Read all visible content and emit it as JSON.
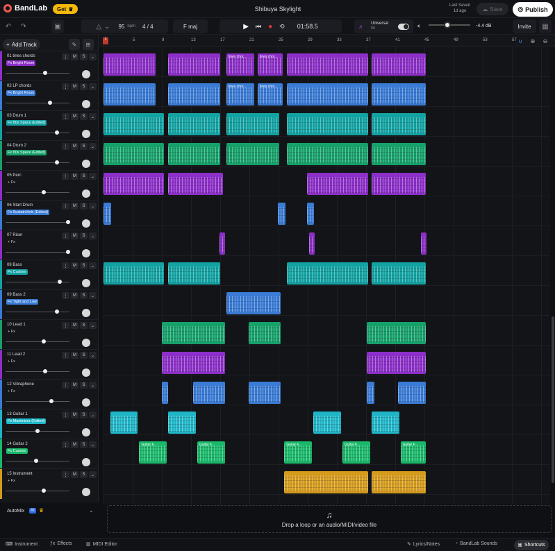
{
  "app": {
    "logo": "BandLab",
    "get_label": "Get",
    "project_title": "Shibuya Skylight",
    "last_saved_label": "Last Saved",
    "last_saved_time": "1d ago",
    "save_label": "Save",
    "publish_label": "Publish"
  },
  "toolbar": {
    "tempo": "95",
    "tempo_unit": "bpm",
    "time_signature": "4 / 4",
    "key": "F maj",
    "time": "01:58.5",
    "preset_name": "Universal",
    "preset_value": "50",
    "volume_db": "-4.4 dB",
    "invite_label": "Invite"
  },
  "panel": {
    "add_track_label": "Add Track",
    "automix_label": "AutoMix",
    "automix_badge": "AI"
  },
  "ruler": {
    "marks": [
      "5",
      "9",
      "13",
      "17",
      "21",
      "25",
      "29",
      "33",
      "37",
      "41",
      "45",
      "49",
      "53",
      "57"
    ],
    "start": "1"
  },
  "tracks": [
    {
      "name": "01  tines chords",
      "fx": "Fx Bright Room",
      "color": "#8c2fc8",
      "vol": 0.62
    },
    {
      "name": "02  LP chords",
      "fx": "Fx Bright Room",
      "color": "#3a7bd5",
      "vol": 0.7
    },
    {
      "name": "03  Drum 1",
      "fx": "Fx 80s Space (Edited)",
      "color": "#13a2a2",
      "vol": 0.8
    },
    {
      "name": "04  Drum 2",
      "fx": "Fx 80s Space (Edited)",
      "color": "#16a06a",
      "vol": 0.8
    },
    {
      "name": "05  Perc",
      "fx": "+ Fx",
      "color": "#8c2fc8",
      "vol": 0.6
    },
    {
      "name": "06  Start Drum",
      "fx": "Fx SustainVerb (Edited)",
      "color": "#3a7bd5",
      "vol": 0.98
    },
    {
      "name": "07  Riser",
      "fx": "+ Fx",
      "color": "#8c2fc8",
      "vol": 0.98
    },
    {
      "name": "08  Bass",
      "fx": "Fx Custom",
      "color": "#13a2a2",
      "vol": 0.85
    },
    {
      "name": "09  Bass 2",
      "fx": "Fx Tight and Low",
      "color": "#3a7bd5",
      "vol": 0.8
    },
    {
      "name": "10  Lead 1",
      "fx": "+ Fx",
      "color": "#16a06a",
      "vol": 0.6
    },
    {
      "name": "11  Lead 2",
      "fx": "+ Fx",
      "color": "#8c2fc8",
      "vol": 0.62
    },
    {
      "name": "12  Vibraphone",
      "fx": "+ Fx",
      "color": "#3a7bd5",
      "vol": 0.72
    },
    {
      "name": "13  Guitar 1",
      "fx": "Fx Maximizer (Edited)",
      "color": "#1fb5c7",
      "vol": 0.5
    },
    {
      "name": "14  Guitar 2",
      "fx": "Fx Custom",
      "color": "#1ab86a",
      "vol": 0.48
    },
    {
      "name": "15  Instrument",
      "fx": "+ Fx",
      "color": "#d49a1c",
      "vol": 0.6
    }
  ],
  "clips": [
    {
      "lane": 0,
      "start": 0.0,
      "end": 0.12,
      "color": "#8c2fc8",
      "label": ""
    },
    {
      "lane": 0,
      "start": 0.145,
      "end": 0.265,
      "color": "#8c2fc8",
      "label": ""
    },
    {
      "lane": 0,
      "start": 0.275,
      "end": 0.34,
      "color": "#8c2fc8",
      "label": "tines chor..."
    },
    {
      "lane": 0,
      "start": 0.345,
      "end": 0.405,
      "color": "#8c2fc8",
      "label": "tines chor..."
    },
    {
      "lane": 0,
      "start": 0.41,
      "end": 0.595,
      "color": "#8c2fc8",
      "label": ""
    },
    {
      "lane": 0,
      "start": 0.6,
      "end": 0.725,
      "color": "#8c2fc8",
      "label": ""
    },
    {
      "lane": 1,
      "start": 0.0,
      "end": 0.12,
      "color": "#3a7bd5",
      "label": ""
    },
    {
      "lane": 1,
      "start": 0.145,
      "end": 0.265,
      "color": "#3a7bd5",
      "label": ""
    },
    {
      "lane": 1,
      "start": 0.275,
      "end": 0.34,
      "color": "#3a7bd5",
      "label": "tines chor..."
    },
    {
      "lane": 1,
      "start": 0.345,
      "end": 0.405,
      "color": "#3a7bd5",
      "label": "tines chor..."
    },
    {
      "lane": 1,
      "start": 0.41,
      "end": 0.595,
      "color": "#3a7bd5",
      "label": ""
    },
    {
      "lane": 1,
      "start": 0.6,
      "end": 0.725,
      "color": "#3a7bd5",
      "label": ""
    },
    {
      "lane": 2,
      "start": 0.0,
      "end": 0.138,
      "color": "#13a2a2",
      "label": ""
    },
    {
      "lane": 2,
      "start": 0.145,
      "end": 0.265,
      "color": "#13a2a2",
      "label": ""
    },
    {
      "lane": 2,
      "start": 0.275,
      "end": 0.397,
      "color": "#13a2a2",
      "label": ""
    },
    {
      "lane": 2,
      "start": 0.41,
      "end": 0.595,
      "color": "#13a2a2",
      "label": ""
    },
    {
      "lane": 2,
      "start": 0.6,
      "end": 0.725,
      "color": "#13a2a2",
      "label": ""
    },
    {
      "lane": 3,
      "start": 0.0,
      "end": 0.138,
      "color": "#16a06a",
      "label": ""
    },
    {
      "lane": 3,
      "start": 0.145,
      "end": 0.265,
      "color": "#16a06a",
      "label": ""
    },
    {
      "lane": 3,
      "start": 0.275,
      "end": 0.397,
      "color": "#16a06a",
      "label": ""
    },
    {
      "lane": 3,
      "start": 0.41,
      "end": 0.595,
      "color": "#16a06a",
      "label": ""
    },
    {
      "lane": 3,
      "start": 0.6,
      "end": 0.725,
      "color": "#16a06a",
      "label": ""
    },
    {
      "lane": 4,
      "start": 0.0,
      "end": 0.138,
      "color": "#8c2fc8",
      "label": ""
    },
    {
      "lane": 4,
      "start": 0.145,
      "end": 0.27,
      "color": "#8c2fc8",
      "label": ""
    },
    {
      "lane": 4,
      "start": 0.455,
      "end": 0.595,
      "color": "#8c2fc8",
      "label": ""
    },
    {
      "lane": 4,
      "start": 0.6,
      "end": 0.725,
      "color": "#8c2fc8",
      "label": ""
    },
    {
      "lane": 5,
      "start": 0.0,
      "end": 0.02,
      "color": "#3a7bd5",
      "label": ""
    },
    {
      "lane": 5,
      "start": 0.39,
      "end": 0.41,
      "color": "#3a7bd5",
      "label": ""
    },
    {
      "lane": 5,
      "start": 0.455,
      "end": 0.475,
      "color": "#3a7bd5",
      "label": ""
    },
    {
      "lane": 6,
      "start": 0.26,
      "end": 0.27,
      "color": "#8c2fc8",
      "label": ""
    },
    {
      "lane": 6,
      "start": 0.46,
      "end": 0.47,
      "color": "#8c2fc8",
      "label": ""
    },
    {
      "lane": 6,
      "start": 0.71,
      "end": 0.722,
      "color": "#8c2fc8",
      "label": ""
    },
    {
      "lane": 7,
      "start": 0.0,
      "end": 0.138,
      "color": "#13a2a2",
      "label": ""
    },
    {
      "lane": 7,
      "start": 0.145,
      "end": 0.265,
      "color": "#13a2a2",
      "label": ""
    },
    {
      "lane": 7,
      "start": 0.41,
      "end": 0.595,
      "color": "#13a2a2",
      "label": ""
    },
    {
      "lane": 7,
      "start": 0.6,
      "end": 0.725,
      "color": "#13a2a2",
      "label": ""
    },
    {
      "lane": 8,
      "start": 0.275,
      "end": 0.4,
      "color": "#3a7bd5",
      "label": ""
    },
    {
      "lane": 9,
      "start": 0.13,
      "end": 0.275,
      "color": "#16a06a",
      "label": ""
    },
    {
      "lane": 9,
      "start": 0.325,
      "end": 0.4,
      "color": "#16a06a",
      "label": ""
    },
    {
      "lane": 9,
      "start": 0.59,
      "end": 0.725,
      "color": "#16a06a",
      "label": ""
    },
    {
      "lane": 10,
      "start": 0.13,
      "end": 0.275,
      "color": "#8c2fc8",
      "label": ""
    },
    {
      "lane": 10,
      "start": 0.59,
      "end": 0.725,
      "color": "#8c2fc8",
      "label": ""
    },
    {
      "lane": 11,
      "start": 0.13,
      "end": 0.148,
      "color": "#3a7bd5",
      "label": ""
    },
    {
      "lane": 11,
      "start": 0.2,
      "end": 0.275,
      "color": "#3a7bd5",
      "label": ""
    },
    {
      "lane": 11,
      "start": 0.325,
      "end": 0.4,
      "color": "#3a7bd5",
      "label": ""
    },
    {
      "lane": 11,
      "start": 0.59,
      "end": 0.61,
      "color": "#3a7bd5",
      "label": ""
    },
    {
      "lane": 11,
      "start": 0.66,
      "end": 0.725,
      "color": "#3a7bd5",
      "label": ""
    },
    {
      "lane": 12,
      "start": 0.015,
      "end": 0.08,
      "color": "#1fb5c7",
      "label": ""
    },
    {
      "lane": 12,
      "start": 0.145,
      "end": 0.21,
      "color": "#1fb5c7",
      "label": ""
    },
    {
      "lane": 12,
      "start": 0.47,
      "end": 0.535,
      "color": "#1fb5c7",
      "label": ""
    },
    {
      "lane": 12,
      "start": 0.6,
      "end": 0.665,
      "color": "#1fb5c7",
      "label": ""
    },
    {
      "lane": 13,
      "start": 0.08,
      "end": 0.145,
      "color": "#1ab86a",
      "label": "Guitar F..."
    },
    {
      "lane": 13,
      "start": 0.21,
      "end": 0.275,
      "color": "#1ab86a",
      "label": "Guitar F..."
    },
    {
      "lane": 13,
      "start": 0.405,
      "end": 0.47,
      "color": "#1ab86a",
      "label": "Guitar F..."
    },
    {
      "lane": 13,
      "start": 0.535,
      "end": 0.6,
      "color": "#1ab86a",
      "label": "Guitar F..."
    },
    {
      "lane": 13,
      "start": 0.665,
      "end": 0.725,
      "color": "#1ab86a",
      "label": "Guitar F..."
    },
    {
      "lane": 14,
      "start": 0.405,
      "end": 0.595,
      "color": "#d49a1c",
      "label": ""
    },
    {
      "lane": 14,
      "start": 0.6,
      "end": 0.725,
      "color": "#d49a1c",
      "label": ""
    }
  ],
  "dropzone": {
    "label": "Drop a loop or an audio/MIDI/video file"
  },
  "bottombar": {
    "instrument": "Instrument",
    "effects": "Effects",
    "midi_editor": "MIDI Editor",
    "lyrics_notes": "Lyrics/Notes",
    "bandlab_sounds": "BandLab Sounds",
    "shortcuts": "Shortcuts"
  }
}
